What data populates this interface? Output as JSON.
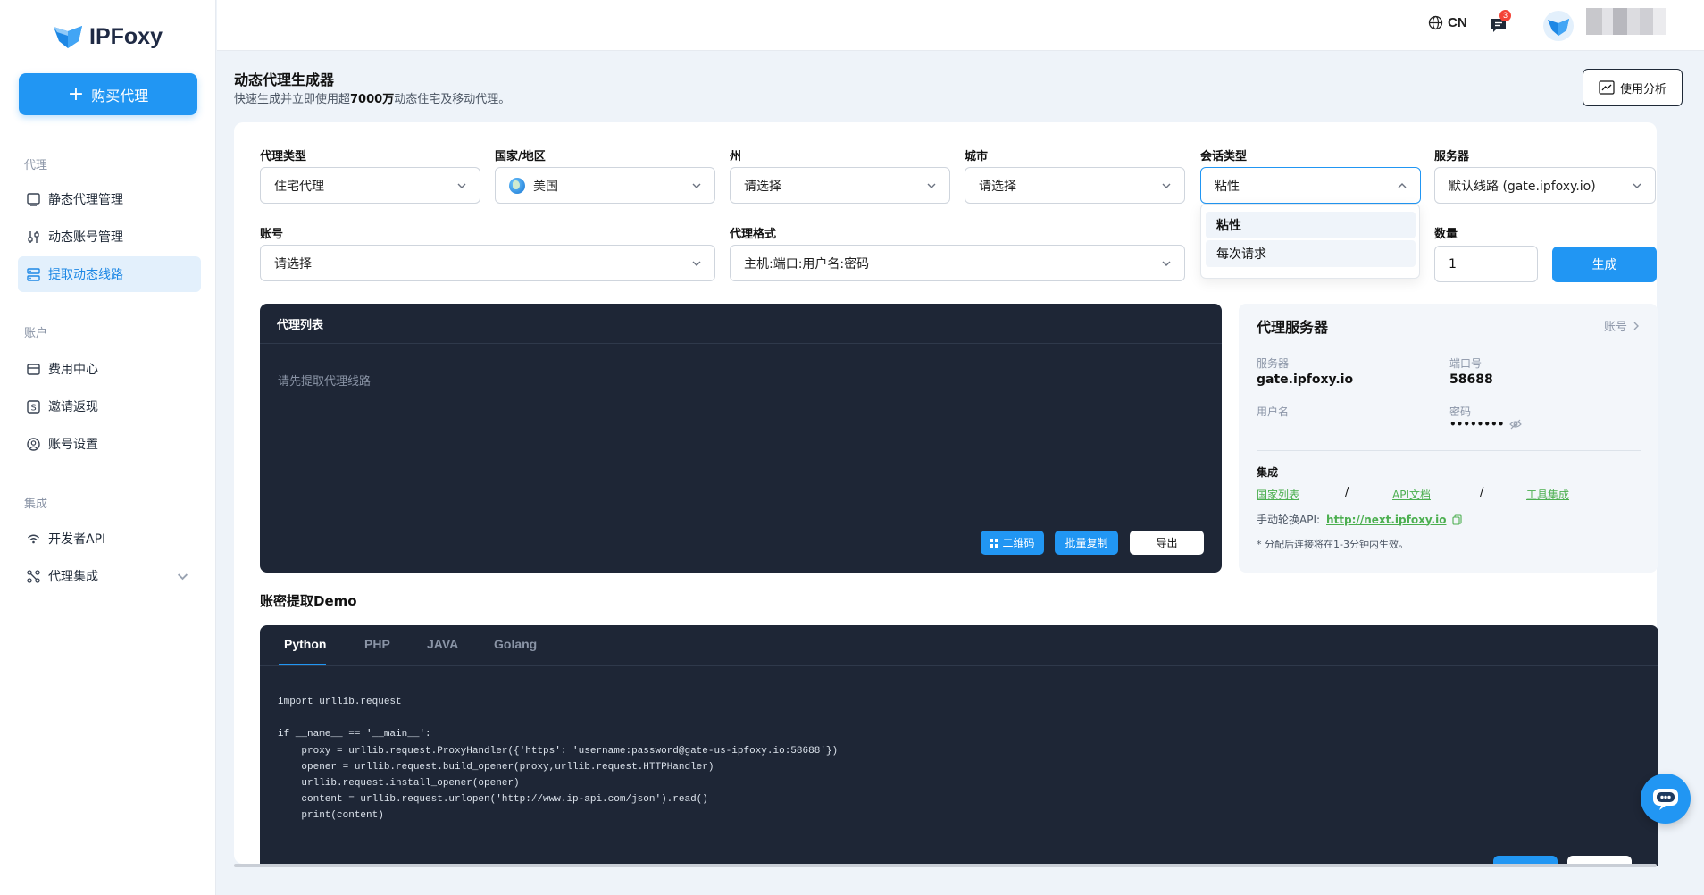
{
  "app": {
    "logo_text": "IPFoxy",
    "buy_label": "购买代理"
  },
  "sidebar": {
    "sections": [
      {
        "title": "代理",
        "items": [
          {
            "label": "静态代理管理",
            "icon": "monitor-icon"
          },
          {
            "label": "动态账号管理",
            "icon": "sliders-icon"
          },
          {
            "label": "提取动态线路",
            "icon": "server-icon",
            "active": true
          }
        ]
      },
      {
        "title": "账户",
        "items": [
          {
            "label": "费用中心",
            "icon": "wallet-icon"
          },
          {
            "label": "邀请返现",
            "icon": "dollar-icon"
          },
          {
            "label": "账号设置",
            "icon": "user-circle-icon"
          }
        ]
      },
      {
        "title": "集成",
        "items": [
          {
            "label": "开发者API",
            "icon": "signal-icon"
          },
          {
            "label": "代理集成",
            "icon": "integration-icon",
            "has_submenu": true
          }
        ]
      }
    ]
  },
  "topbar": {
    "lang": "CN",
    "message_count": "3"
  },
  "page": {
    "title": "动态代理生成器",
    "subtitle_pre": "快速生成并立即使用超",
    "subtitle_bold": "7000万",
    "subtitle_post": "动态住宅及移动代理。",
    "analysis_label": "使用分析"
  },
  "form": {
    "proxy_type": {
      "label": "代理类型",
      "value": "住宅代理"
    },
    "country": {
      "label": "国家/地区",
      "value": "美国"
    },
    "state": {
      "label": "州",
      "value": "请选择"
    },
    "city": {
      "label": "城市",
      "value": "请选择"
    },
    "session": {
      "label": "会话类型",
      "value": "粘性",
      "options": [
        "粘性",
        "每次请求"
      ]
    },
    "server": {
      "label": "服务器",
      "value": "默认线路 (gate.ipfoxy.io)"
    },
    "account": {
      "label": "账号",
      "value": "请选择"
    },
    "format": {
      "label": "代理格式",
      "value": "主机:端口:用户名:密码"
    },
    "quantity": {
      "label": "数量",
      "value": "1"
    },
    "generate_label": "生成"
  },
  "proxy_list": {
    "title": "代理列表",
    "empty": "请先提取代理线路",
    "qr_label": "二维码",
    "copy_label": "批量复制",
    "export_label": "导出"
  },
  "proxy_server": {
    "title": "代理服务器",
    "account_link": "账号",
    "server_label": "服务器",
    "server_value": "gate.ipfoxy.io",
    "port_label": "端口号",
    "port_value": "58688",
    "username_label": "用户名",
    "password_label": "密码",
    "password_value": "••••••••",
    "integration_label": "集成",
    "links": [
      "国家列表",
      "API文档",
      "工具集成"
    ],
    "rotate_label": "手动轮换API:",
    "rotate_url": "http://next.ipfoxy.io",
    "note": "* 分配后连接将在1-3分钟内生效。"
  },
  "demo": {
    "title": "账密提取Demo",
    "tabs": [
      "Python",
      "PHP",
      "JAVA",
      "Golang"
    ],
    "active_tab": "Python",
    "code": "import urllib.request\n\nif __name__ == '__main__':\n    proxy = urllib.request.ProxyHandler({'https': 'username:password@gate-us-ipfoxy.io:58688'})\n    opener = urllib.request.build_opener(proxy,urllib.request.HTTPHandler)\n    urllib.request.install_opener(opener)\n    content = urllib.request.urlopen('http://www.ip-api.com/json').read()\n    print(content)"
  },
  "colors": {
    "accent": "#2196f3",
    "dark_panel": "#1e2636",
    "link_green": "#4caf50"
  }
}
